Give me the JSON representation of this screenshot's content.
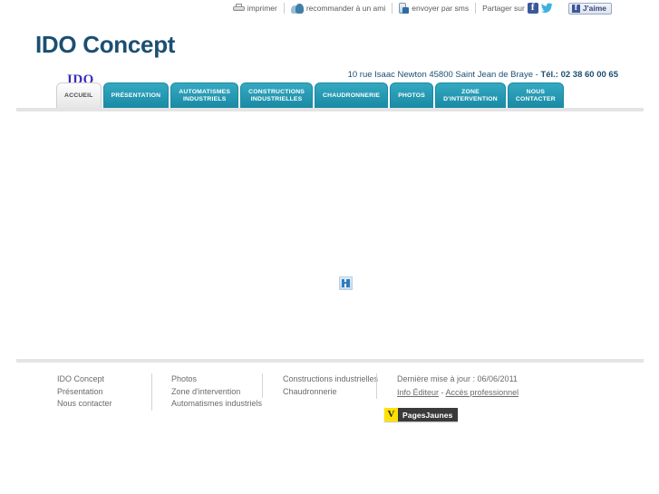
{
  "topbar": {
    "print_label": "imprimer",
    "recommend_label": "recommander à un ami",
    "sms_label": "envoyer par sms",
    "share_label": "Partager sur",
    "like_label": "J'aime"
  },
  "header": {
    "site_title": "IDO Concept",
    "logo_text": "IDO",
    "address": "10 rue Isaac Newton 45800 Saint Jean de Braye",
    "separator": " -  ",
    "tel_label": "Tél.: 02 38 60 00 65"
  },
  "nav": {
    "tabs": [
      {
        "label": "ACCUEIL",
        "active": true
      },
      {
        "label": "PRÉSENTATION",
        "active": false
      },
      {
        "label": "AUTOMATISMES\nINDUSTRIELS",
        "active": false
      },
      {
        "label": "CONSTRUCTIONS\nINDUSTRIELLES",
        "active": false
      },
      {
        "label": "CHAUDRONNERIE",
        "active": false
      },
      {
        "label": "PHOTOS",
        "active": false
      },
      {
        "label": "ZONE\nD'INTERVENTION",
        "active": false
      },
      {
        "label": "NOUS\nCONTACTER",
        "active": false
      }
    ]
  },
  "main": {
    "broken_image_icon": "broken-image-icon"
  },
  "footer": {
    "col1": [
      "IDO Concept",
      "Présentation",
      "Nous contacter"
    ],
    "col2": [
      "Photos",
      "Zone d'intervention",
      "Automatismes industriels"
    ],
    "col3": [
      "Constructions industrielles",
      "Chaudronnerie"
    ],
    "last_update": "Dernière mise à jour : 06/06/2011",
    "editor_link": "Info Éditeur",
    "link_separator": " - ",
    "pro_link": "Accès professionnel",
    "pj_mark": "V",
    "pj_name": "PagesJaunes"
  },
  "colors": {
    "tab_teal": "#1a8aa3",
    "title_blue": "#1b4f72",
    "logo_purple": "#3a2bbf",
    "facebook_blue": "#3b5998",
    "pj_yellow": "#ffe200"
  }
}
